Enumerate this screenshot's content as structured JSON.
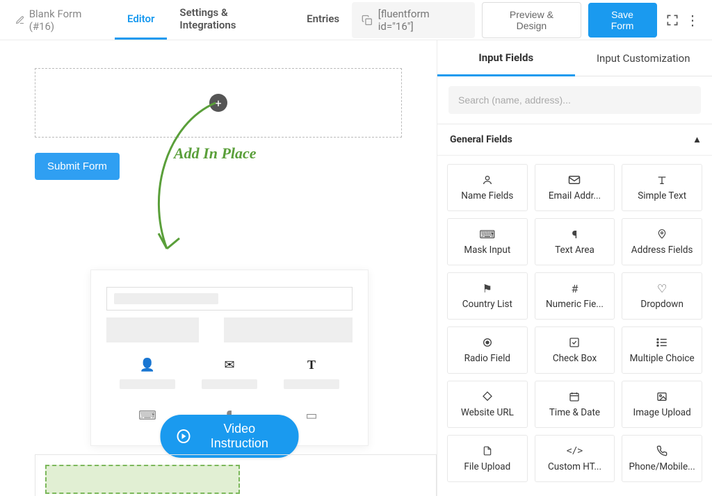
{
  "form": {
    "title": "Blank Form (#16)"
  },
  "tabs": {
    "editor": "Editor",
    "settings": "Settings & Integrations",
    "entries": "Entries"
  },
  "shortcode": "[fluentform id=\"16\"]",
  "buttons": {
    "preview": "Preview & Design",
    "save": "Save Form",
    "submit": "Submit Form",
    "video": "Video Instruction"
  },
  "hint": "Add In Place",
  "sidebar": {
    "tabs": {
      "input": "Input Fields",
      "customize": "Input Customization"
    },
    "search_placeholder": "Search (name, address)...",
    "section": "General Fields",
    "fields": [
      {
        "icon": "user",
        "label": "Name Fields"
      },
      {
        "icon": "mail",
        "label": "Email Addr..."
      },
      {
        "icon": "text",
        "label": "Simple Text"
      },
      {
        "icon": "mask",
        "label": "Mask Input"
      },
      {
        "icon": "para",
        "label": "Text Area"
      },
      {
        "icon": "pin",
        "label": "Address Fields"
      },
      {
        "icon": "flag",
        "label": "Country List"
      },
      {
        "icon": "hash",
        "label": "Numeric Fie..."
      },
      {
        "icon": "heart",
        "label": "Dropdown"
      },
      {
        "icon": "radio",
        "label": "Radio Field"
      },
      {
        "icon": "check",
        "label": "Check Box"
      },
      {
        "icon": "list",
        "label": "Multiple Choice"
      },
      {
        "icon": "link",
        "label": "Website URL"
      },
      {
        "icon": "calendar",
        "label": "Time & Date"
      },
      {
        "icon": "image",
        "label": "Image Upload"
      },
      {
        "icon": "file",
        "label": "File Upload"
      },
      {
        "icon": "code",
        "label": "Custom HT..."
      },
      {
        "icon": "phone",
        "label": "Phone/Mobile..."
      }
    ]
  },
  "icons": {
    "user": "◯",
    "mail": "✉",
    "text": "T",
    "mask": "⌨",
    "para": "¶",
    "pin": "◎",
    "flag": "⚑",
    "hash": "#",
    "heart": "♡",
    "radio": "◉",
    "check": "☑",
    "list": "☰",
    "link": "◇",
    "calendar": "🗓",
    "image": "▣",
    "file": "⎘",
    "code": "</>",
    "phone": "✆"
  }
}
